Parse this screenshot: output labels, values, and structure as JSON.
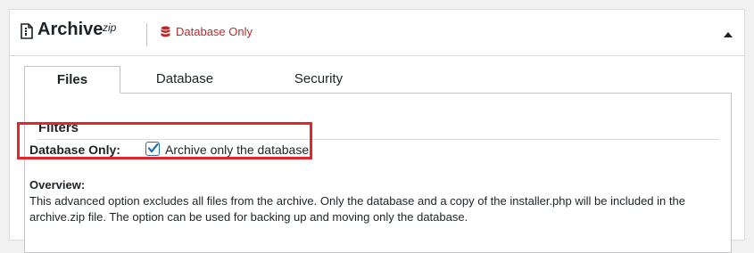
{
  "header": {
    "title": "Archive",
    "title_superscript": "zip",
    "badge_label": "Database Only",
    "icons": {
      "title": "archive-file-icon",
      "badge": "database-icon",
      "toggle": "caret-up-icon"
    }
  },
  "tabs": [
    {
      "label": "Files",
      "active": true
    },
    {
      "label": "Database",
      "active": false
    },
    {
      "label": "Security",
      "active": false
    }
  ],
  "filters": {
    "section_title": "Filters",
    "database_only_label": "Database Only:",
    "database_only_checked": true,
    "checkbox_label": "Archive only the database"
  },
  "overview": {
    "label": "Overview:",
    "text": "This advanced option excludes all files from the archive. Only the database and a copy of the installer.php will be included in the archive.zip file. The option can be used for backing up and moving only the database."
  },
  "colors": {
    "accent": "#2271b1",
    "badge_red": "#b32d2e",
    "highlight_red": "#e1272b",
    "background": "#f1f1f1"
  }
}
